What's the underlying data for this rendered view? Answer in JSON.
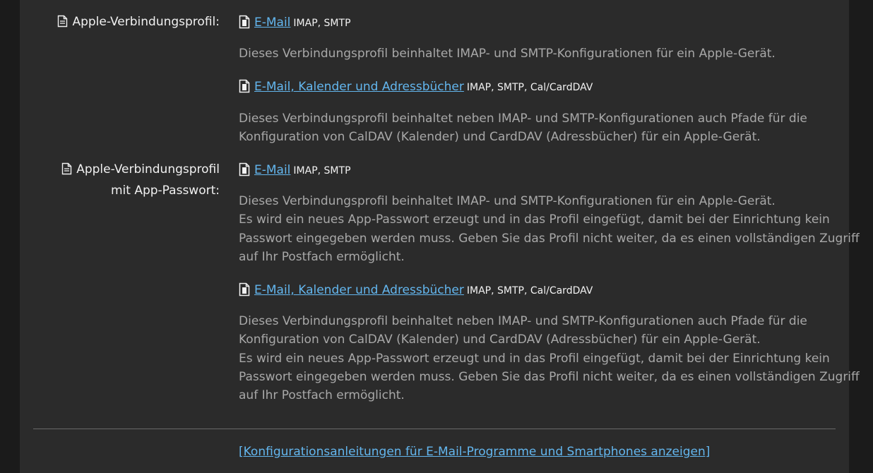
{
  "sections": [
    {
      "label_line1": "Apple-Verbindungsprofil:",
      "label_line2": "",
      "entries": [
        {
          "link": "E-Mail",
          "protocols": "IMAP, SMTP",
          "desc_lines": [
            "Dieses Verbindungsprofil beinhaltet IMAP- und SMTP-Konfigurationen für ein Apple-Gerät."
          ]
        },
        {
          "link": "E-Mail, Kalender und Adressbücher",
          "protocols": "IMAP, SMTP, Cal/CardDAV",
          "desc_lines": [
            "Dieses Verbindungsprofil beinhaltet neben IMAP- und SMTP-Konfigurationen auch Pfade für die",
            "Konfiguration von CalDAV (Kalender) und CardDAV (Adressbücher) für ein Apple-Gerät."
          ]
        }
      ]
    },
    {
      "label_line1": "Apple-Verbindungsprofil",
      "label_line2": "mit App-Passwort:",
      "entries": [
        {
          "link": "E-Mail",
          "protocols": "IMAP, SMTP",
          "desc_lines": [
            "Dieses Verbindungsprofil beinhaltet IMAP- und SMTP-Konfigurationen für ein Apple-Gerät.",
            "Es wird ein neues App-Passwort erzeugt und in das Profil eingefügt, damit bei der Einrichtung kein",
            "Passwort eingegeben werden muss. Geben Sie das Profil nicht weiter, da es einen vollständigen Zugriff",
            "auf Ihr Postfach ermöglicht."
          ]
        },
        {
          "link": "E-Mail, Kalender und Adressbücher",
          "protocols": "IMAP, SMTP, Cal/CardDAV",
          "desc_lines": [
            "Dieses Verbindungsprofil beinhaltet neben IMAP- und SMTP-Konfigurationen auch Pfade für die",
            "Konfiguration von CalDAV (Kalender) und CardDAV (Adressbücher) für ein Apple-Gerät.",
            "Es wird ein neues App-Passwort erzeugt und in das Profil eingefügt, damit bei der Einrichtung kein",
            "Passwort eingegeben werden muss. Geben Sie das Profil nicht weiter, da es einen vollständigen Zugriff",
            "auf Ihr Postfach ermöglicht."
          ]
        }
      ]
    }
  ],
  "footer_link": "[Konfigurationsanleitungen für E-Mail-Programme und Smartphones anzeigen]",
  "icons": {
    "section": "document-lines-icon",
    "entry": "profile-file-icon"
  },
  "colors": {
    "panel_bg": "#2b2b2b",
    "page_bg": "#1b1b1b",
    "link": "#63b6ee",
    "label": "#f0f0f0",
    "description": "#a8a8a8"
  }
}
